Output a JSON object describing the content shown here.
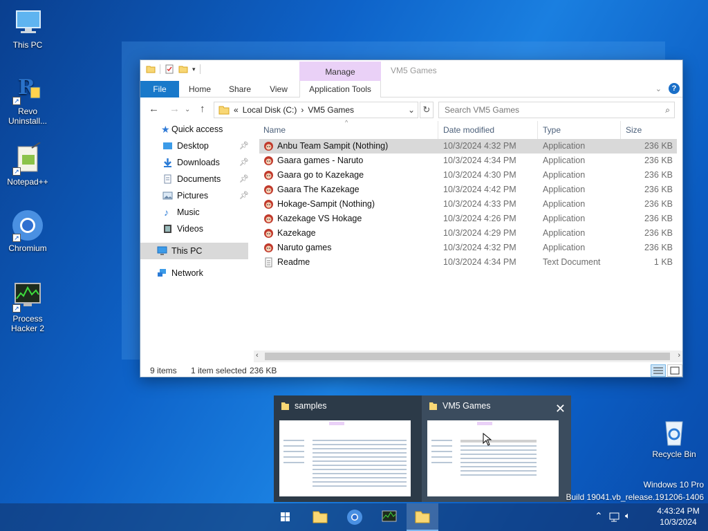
{
  "desktop": {
    "icons": [
      {
        "label": "This PC",
        "icon": "monitor-icon"
      },
      {
        "label": "Revo Uninstall...",
        "icon": "revo-icon"
      },
      {
        "label": "Notepad++",
        "icon": "notepadpp-icon"
      },
      {
        "label": "Chromium",
        "icon": "chromium-icon"
      },
      {
        "label": "Process Hacker 2",
        "icon": "process-hacker-icon"
      },
      {
        "label": "Recycle Bin",
        "icon": "recycle-bin-icon"
      }
    ],
    "watermark": {
      "line1": "Windows 10 Pro",
      "line2": "Build 19041.vb_release.191206-1406"
    }
  },
  "window": {
    "title": "VM5 Games",
    "manage_label": "Manage",
    "tabs": {
      "file": "File",
      "home": "Home",
      "share": "Share",
      "view": "View",
      "app_tools": "Application Tools"
    },
    "address": {
      "prefix": "«",
      "segment1": "Local Disk (C:)",
      "sep": "›",
      "segment2": "VM5 Games"
    },
    "search_placeholder": "Search VM5 Games",
    "nav": {
      "quick_access": "Quick access",
      "desktop": "Desktop",
      "downloads": "Downloads",
      "documents": "Documents",
      "pictures": "Pictures",
      "music": "Music",
      "videos": "Videos",
      "this_pc": "This PC",
      "network": "Network"
    },
    "columns": {
      "name": "Name",
      "date": "Date modified",
      "type": "Type",
      "size": "Size"
    },
    "files": [
      {
        "name": "Anbu Team Sampit (Nothing)",
        "date": "10/3/2024 4:32 PM",
        "type": "Application",
        "size": "236 KB"
      },
      {
        "name": "Gaara games - Naruto",
        "date": "10/3/2024 4:34 PM",
        "type": "Application",
        "size": "236 KB"
      },
      {
        "name": "Gaara go to Kazekage",
        "date": "10/3/2024 4:30 PM",
        "type": "Application",
        "size": "236 KB"
      },
      {
        "name": "Gaara The Kazekage",
        "date": "10/3/2024 4:42 PM",
        "type": "Application",
        "size": "236 KB"
      },
      {
        "name": "Hokage-Sampit (Nothing)",
        "date": "10/3/2024 4:33 PM",
        "type": "Application",
        "size": "236 KB"
      },
      {
        "name": "Kazekage VS Hokage",
        "date": "10/3/2024 4:26 PM",
        "type": "Application",
        "size": "236 KB"
      },
      {
        "name": "Kazekage",
        "date": "10/3/2024 4:29 PM",
        "type": "Application",
        "size": "236 KB"
      },
      {
        "name": "Naruto games",
        "date": "10/3/2024 4:32 PM",
        "type": "Application",
        "size": "236 KB"
      },
      {
        "name": "Readme",
        "date": "10/3/2024 4:34 PM",
        "type": "Text Document",
        "size": "1 KB"
      }
    ],
    "status": {
      "count": "9 items",
      "selected": "1 item selected",
      "selected_size": "236 KB"
    }
  },
  "preview": {
    "cards": [
      {
        "title": "samples"
      },
      {
        "title": "VM5 Games"
      }
    ]
  },
  "taskbar": {
    "time": "4:43:24 PM",
    "date": "10/3/2024"
  },
  "colors": {
    "accent": "#1979ca",
    "manage_tab": "#ead1f7",
    "selection": "#d9d9d9"
  }
}
